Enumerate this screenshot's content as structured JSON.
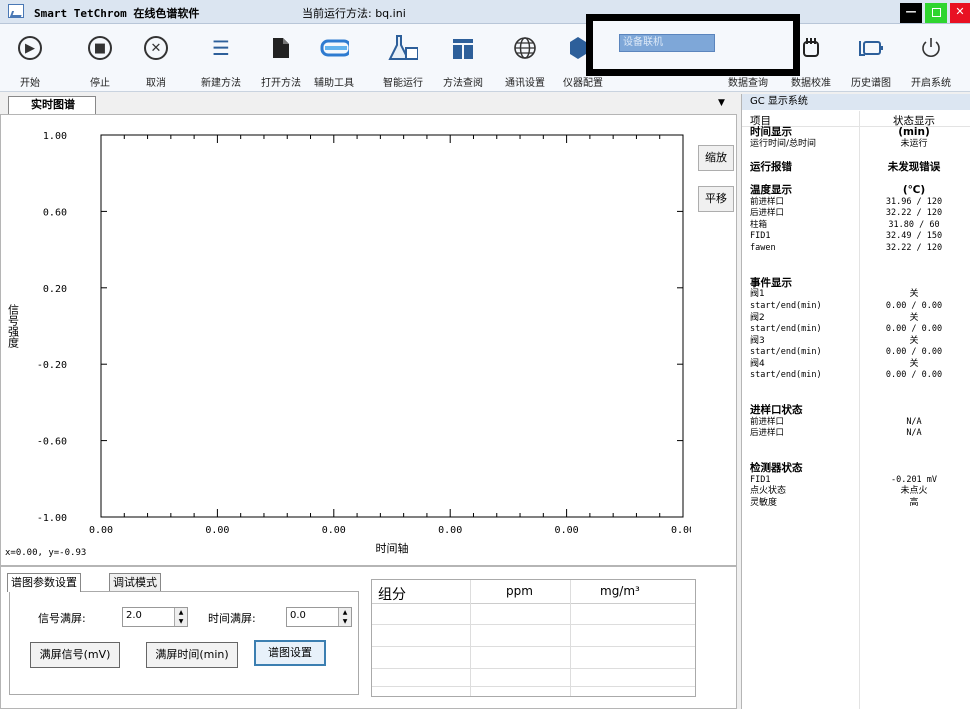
{
  "titlebar": {
    "app_title": "Smart TetChrom 在线色谱软件",
    "method_label": "当前运行方法: bq.ini"
  },
  "toolbar": {
    "items": [
      {
        "label": "开始",
        "icon": "play-icon"
      },
      {
        "label": "停止",
        "icon": "stop-icon"
      },
      {
        "label": "取消",
        "icon": "cancel-icon"
      },
      {
        "label": "新建方法",
        "icon": "new-method-icon"
      },
      {
        "label": "打开方法",
        "icon": "open-file-icon"
      },
      {
        "label": "辅助工具",
        "icon": "goggles-icon"
      },
      {
        "label": "智能运行",
        "icon": "flask-icon"
      },
      {
        "label": "方法查阅",
        "icon": "book-icon"
      },
      {
        "label": "通讯设置",
        "icon": "globe-icon"
      },
      {
        "label": "仪器配置",
        "icon": "instrument-icon"
      },
      {
        "label": "数据查询",
        "icon": "search-icon"
      },
      {
        "label": "数据校准",
        "icon": "calibrate-icon"
      },
      {
        "label": "历史谱图",
        "icon": "history-icon"
      },
      {
        "label": "开启系统",
        "icon": "power-icon"
      }
    ],
    "overlay_selection": "设备联机"
  },
  "tabs": {
    "realtime": "实时图谱"
  },
  "chart_controls": {
    "zoom": "缩放",
    "pan": "平移",
    "coord_readout": "x=0.00, y=-0.93"
  },
  "chart_data": {
    "type": "line",
    "series": [],
    "x_ticks": [
      "0.00",
      "0.00",
      "0.00",
      "0.00",
      "0.00",
      "0.00"
    ],
    "y_ticks": [
      "1.00",
      "0.60",
      "0.20",
      "-0.20",
      "-0.60",
      "-1.00"
    ],
    "xlabel": "时间轴",
    "ylabel": "信号强度",
    "ylim": [
      -1.0,
      1.0
    ]
  },
  "bottom": {
    "tab_params": "谱图参数设置",
    "tab_debug": "调试模式",
    "signal_label": "信号满屏:",
    "signal_value": "2.0",
    "time_label": "时间满屏:",
    "time_value": "0.0",
    "btn_signal": "满屏信号(mV)",
    "btn_time": "满屏时间(min)",
    "btn_settings": "谱图设置",
    "table_headers": [
      "组分",
      "ppm",
      "mg/m³"
    ]
  },
  "gc_panel": {
    "title": "GC 显示系统",
    "col_item": "项目",
    "col_status": "状态显示",
    "rows": [
      {
        "k": "时间显示",
        "v": "(min)",
        "style": "hdr"
      },
      {
        "k": "运行时间/总时间",
        "v": "未运行",
        "style": ""
      },
      {
        "k": "",
        "v": "",
        "style": ""
      },
      {
        "k": "运行报错",
        "v": "未发现错误",
        "style": "hdr"
      },
      {
        "k": "",
        "v": "",
        "style": ""
      },
      {
        "k": "温度显示",
        "v": "(℃)",
        "style": "hdr"
      },
      {
        "k": "前进样口",
        "v": "31.96 / 120",
        "style": "mono"
      },
      {
        "k": "后进样口",
        "v": "32.22 / 120",
        "style": "mono"
      },
      {
        "k": "柱箱",
        "v": "31.80 / 60",
        "style": "mono"
      },
      {
        "k": "FID1",
        "v": "32.49 / 150",
        "style": "mono"
      },
      {
        "k": "fawen",
        "v": "32.22 / 120",
        "style": "mono"
      },
      {
        "k": "",
        "v": "",
        "style": ""
      },
      {
        "k": "",
        "v": "",
        "style": ""
      },
      {
        "k": "事件显示",
        "v": "",
        "style": "hdr"
      },
      {
        "k": "阀1",
        "v": "关",
        "style": ""
      },
      {
        "k": "start/end(min)",
        "v": "0.00 / 0.00",
        "style": "mono"
      },
      {
        "k": "阀2",
        "v": "关",
        "style": ""
      },
      {
        "k": "start/end(min)",
        "v": "0.00 / 0.00",
        "style": "mono"
      },
      {
        "k": "阀3",
        "v": "关",
        "style": ""
      },
      {
        "k": "start/end(min)",
        "v": "0.00 / 0.00",
        "style": "mono"
      },
      {
        "k": "阀4",
        "v": "关",
        "style": ""
      },
      {
        "k": "start/end(min)",
        "v": "0.00 / 0.00",
        "style": "mono"
      },
      {
        "k": "",
        "v": "",
        "style": ""
      },
      {
        "k": "",
        "v": "",
        "style": ""
      },
      {
        "k": "进样口状态",
        "v": "",
        "style": "hdr"
      },
      {
        "k": "前进样口",
        "v": "N/A",
        "style": "mono"
      },
      {
        "k": "后进样口",
        "v": "N/A",
        "style": "mono"
      },
      {
        "k": "",
        "v": "",
        "style": ""
      },
      {
        "k": "",
        "v": "",
        "style": ""
      },
      {
        "k": "检测器状态",
        "v": "",
        "style": "hdr"
      },
      {
        "k": "FID1",
        "v": "-0.201 mV",
        "style": "mono"
      },
      {
        "k": "点火状态",
        "v": "未点火",
        "style": ""
      },
      {
        "k": "灵敏度",
        "v": "高",
        "style": ""
      }
    ]
  }
}
